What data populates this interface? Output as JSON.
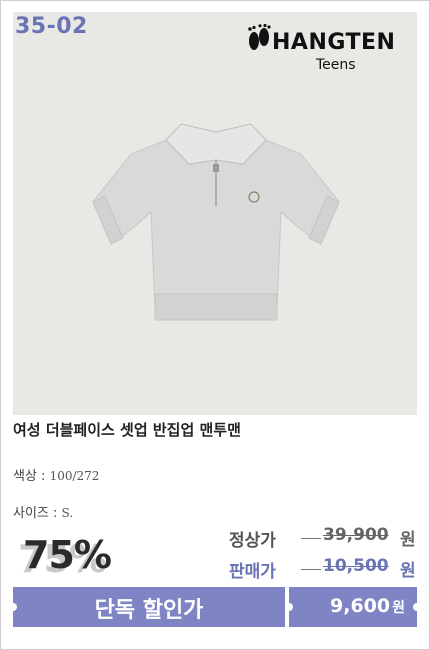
{
  "card": {
    "code": "35-02",
    "brand_name": "HANGTEN",
    "brand_sub": "Teens",
    "icons": [
      "footprints-logo-icon",
      "garment-image"
    ]
  },
  "product": {
    "title": "여성 더블페이스 셋업 반집업 맨투맨",
    "color_label": "색상 :",
    "color_value": "100/272",
    "size_label": "사이즈 :",
    "size_value": "S."
  },
  "pricing": {
    "discount": "75%",
    "regular_label": "정상가",
    "regular_price": "39,900",
    "sale_label": "판매가",
    "sale_price": "10,500",
    "currency": "원"
  },
  "bar": {
    "label": "단독 할인가",
    "price": "9,600",
    "currency": "원"
  },
  "colors": {
    "accent": "#7e84c4",
    "code": "#6a73b4",
    "photo_bg": "#e9e8e4"
  }
}
